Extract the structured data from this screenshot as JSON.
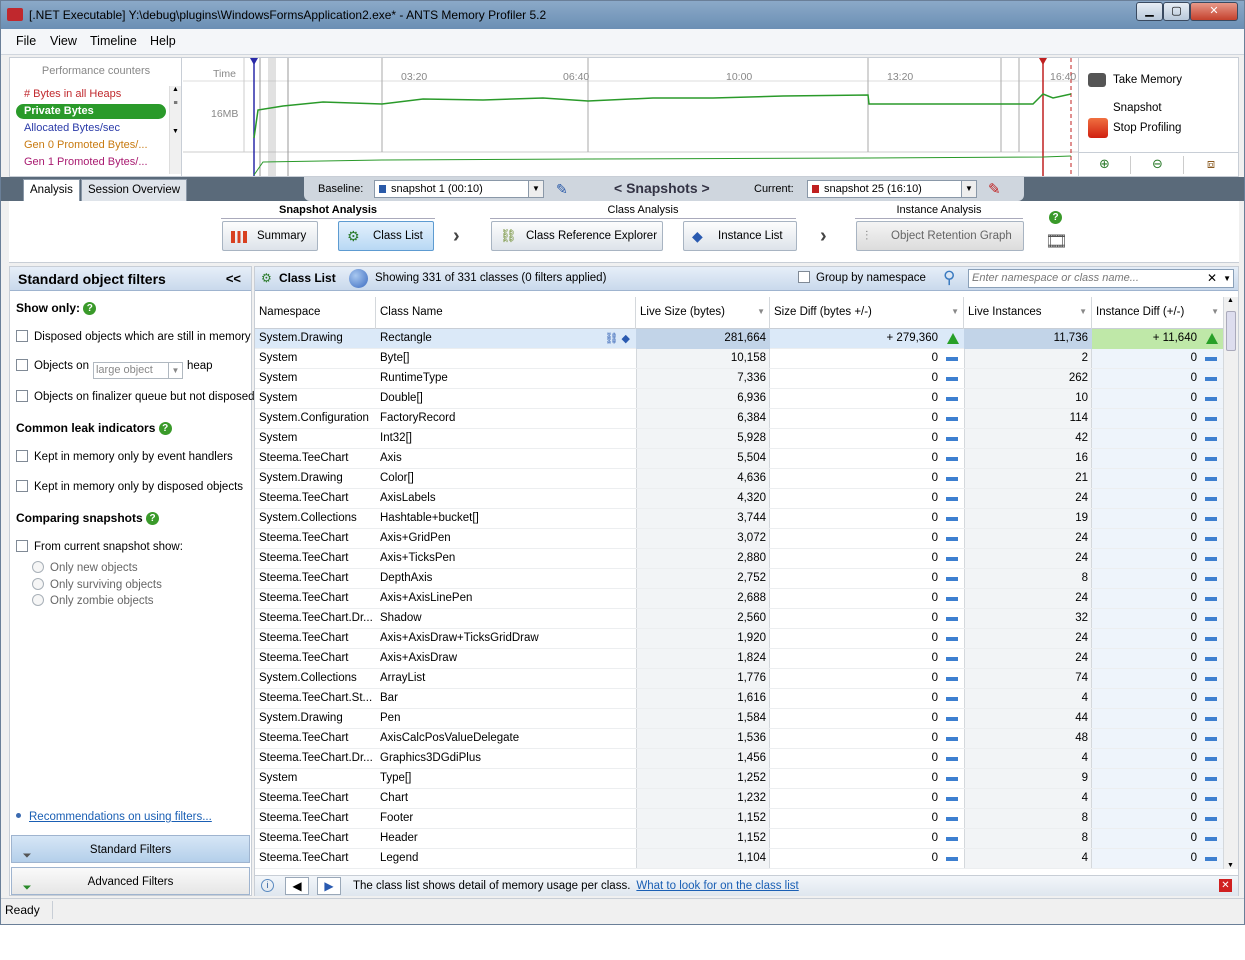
{
  "window": {
    "title": "[.NET Executable] Y:\\debug\\plugins\\WindowsFormsApplication2.exe* - ANTS Memory Profiler 5.2"
  },
  "menu": [
    "File",
    "View",
    "Timeline",
    "Help"
  ],
  "perf": {
    "header": "Performance counters",
    "time_label": "Time",
    "mb_label": "16MB",
    "counters": [
      {
        "label": "# Bytes in all Heaps",
        "color": "#c0282d"
      },
      {
        "label": "Private Bytes",
        "color": "#ffffff"
      },
      {
        "label": "Allocated Bytes/sec",
        "color": "#2a3aa8"
      },
      {
        "label": "Gen 0 Promoted Bytes/...",
        "color": "#c87a10"
      },
      {
        "label": "Gen 1 Promoted Bytes/...",
        "color": "#a81a70"
      }
    ],
    "times": [
      "03:20",
      "06:40",
      "10:00",
      "13:20",
      "16:40"
    ],
    "buttons": {
      "take": "Take Memory Snapshot",
      "stop": "Stop Profiling"
    }
  },
  "tabs": [
    "Analysis",
    "Session Overview"
  ],
  "snapshots": {
    "baseline_label": "Baseline:",
    "baseline": "snapshot 1 (00:10)",
    "nav": "< Snapshots >",
    "current_label": "Current:",
    "current": "snapshot 25 (16:10)"
  },
  "navstrip": {
    "snapshot_group": "Snapshot Analysis",
    "class_group": "Class Analysis",
    "instance_group": "Instance Analysis",
    "summary": "Summary",
    "class_list": "Class List",
    "class_ref": "Class Reference Explorer",
    "instance_list": "Instance List",
    "retention": "Object Retention Graph"
  },
  "filters": {
    "title": "Standard object filters",
    "collapse": "<<",
    "show_only": "Show only:",
    "disposed": "Disposed objects which are still in memory",
    "objects_on": "Objects on",
    "heap_select": "large object",
    "heap": "heap",
    "finalizer": "Objects on finalizer queue but not disposed",
    "leak": "Common leak indicators",
    "event_handlers": "Kept in memory only by event handlers",
    "disposed_objects": "Kept in memory only by disposed objects",
    "comparing": "Comparing snapshots",
    "from_current": "From current snapshot show:",
    "only_new": "Only new objects",
    "only_surviving": "Only surviving objects",
    "only_zombie": "Only zombie objects",
    "recommendations": "Recommendations on using filters...",
    "standard": "Standard Filters",
    "advanced": "Advanced Filters"
  },
  "classlist": {
    "title": "Class List",
    "info": "Showing 331 of 331 classes (0 filters applied)",
    "group_by": "Group by namespace",
    "search_placeholder": "Enter namespace or class name...",
    "columns": [
      "Namespace",
      "Class Name",
      "Live Size (bytes)",
      "Size Diff (bytes +/-)",
      "Live Instances",
      "Instance Diff (+/-)"
    ],
    "rows": [
      [
        "System.Drawing",
        "Rectangle",
        "281,664",
        "+ 279,360",
        "11,736",
        "+ 11,640"
      ],
      [
        "System",
        "Byte[]",
        "10,158",
        "0",
        "2",
        "0"
      ],
      [
        "System",
        "RuntimeType",
        "7,336",
        "0",
        "262",
        "0"
      ],
      [
        "System",
        "Double[]",
        "6,936",
        "0",
        "10",
        "0"
      ],
      [
        "System.Configuration",
        "FactoryRecord",
        "6,384",
        "0",
        "114",
        "0"
      ],
      [
        "System",
        "Int32[]",
        "5,928",
        "0",
        "42",
        "0"
      ],
      [
        "Steema.TeeChart",
        "Axis",
        "5,504",
        "0",
        "16",
        "0"
      ],
      [
        "System.Drawing",
        "Color[]",
        "4,636",
        "0",
        "21",
        "0"
      ],
      [
        "Steema.TeeChart",
        "AxisLabels",
        "4,320",
        "0",
        "24",
        "0"
      ],
      [
        "System.Collections",
        "Hashtable+bucket[]",
        "3,744",
        "0",
        "19",
        "0"
      ],
      [
        "Steema.TeeChart",
        "Axis+GridPen",
        "3,072",
        "0",
        "24",
        "0"
      ],
      [
        "Steema.TeeChart",
        "Axis+TicksPen",
        "2,880",
        "0",
        "24",
        "0"
      ],
      [
        "Steema.TeeChart",
        "DepthAxis",
        "2,752",
        "0",
        "8",
        "0"
      ],
      [
        "Steema.TeeChart",
        "Axis+AxisLinePen",
        "2,688",
        "0",
        "24",
        "0"
      ],
      [
        "Steema.TeeChart.Dr...",
        "Shadow",
        "2,560",
        "0",
        "32",
        "0"
      ],
      [
        "Steema.TeeChart",
        "Axis+AxisDraw+TicksGridDraw",
        "1,920",
        "0",
        "24",
        "0"
      ],
      [
        "Steema.TeeChart",
        "Axis+AxisDraw",
        "1,824",
        "0",
        "24",
        "0"
      ],
      [
        "System.Collections",
        "ArrayList",
        "1,776",
        "0",
        "74",
        "0"
      ],
      [
        "Steema.TeeChart.St...",
        "Bar",
        "1,616",
        "0",
        "4",
        "0"
      ],
      [
        "System.Drawing",
        "Pen",
        "1,584",
        "0",
        "44",
        "0"
      ],
      [
        "Steema.TeeChart",
        "AxisCalcPosValueDelegate",
        "1,536",
        "0",
        "48",
        "0"
      ],
      [
        "Steema.TeeChart.Dr...",
        "Graphics3DGdiPlus",
        "1,456",
        "0",
        "4",
        "0"
      ],
      [
        "System",
        "Type[]",
        "1,252",
        "0",
        "9",
        "0"
      ],
      [
        "Steema.TeeChart",
        "Chart",
        "1,232",
        "0",
        "4",
        "0"
      ],
      [
        "Steema.TeeChart",
        "Footer",
        "1,152",
        "0",
        "8",
        "0"
      ],
      [
        "Steema.TeeChart",
        "Header",
        "1,152",
        "0",
        "8",
        "0"
      ],
      [
        "Steema.TeeChart",
        "Legend",
        "1,104",
        "0",
        "4",
        "0"
      ]
    ],
    "bottom_text": "The class list shows detail of memory usage per class.",
    "bottom_link": "What to look for on the class list"
  },
  "status": "Ready"
}
